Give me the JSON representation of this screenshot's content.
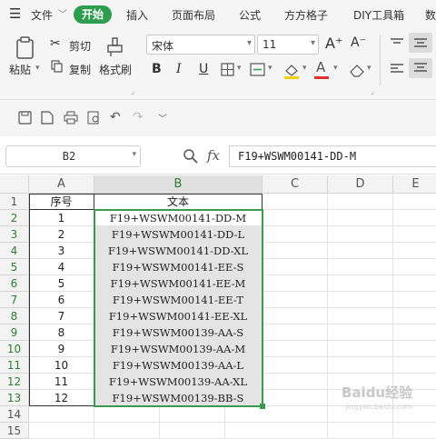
{
  "menubar": {
    "file": "文件",
    "tabs": [
      "开始",
      "插入",
      "页面布局",
      "公式",
      "方方格子",
      "DIY工具箱",
      "数"
    ]
  },
  "ribbon": {
    "paste": "粘贴",
    "cut": "剪切",
    "copy": "复制",
    "format_painter": "格式刷",
    "font_name": "宋体",
    "font_size": "11",
    "bold": "B",
    "italic": "I",
    "underline": "U",
    "increase_font": "A⁺",
    "decrease_font": "A⁻",
    "font_color_letter": "A",
    "colors": {
      "highlight": "#f5d000",
      "font": "#e03030",
      "accent": "#2e9d4f"
    }
  },
  "formula_bar": {
    "name_box": "B2",
    "fx": "fx",
    "formula": "F19+WSWM00141-DD-M"
  },
  "sheet": {
    "columns": [
      "A",
      "B",
      "C",
      "D",
      "E"
    ],
    "rows": [
      "1",
      "2",
      "3",
      "4",
      "5",
      "6",
      "7",
      "8",
      "9",
      "10",
      "11",
      "12",
      "13",
      "14",
      "15"
    ],
    "data": [
      [
        "序号",
        "文本"
      ],
      [
        "1",
        "F19+WSWM00141-DD-M"
      ],
      [
        "2",
        "F19+WSWM00141-DD-L"
      ],
      [
        "3",
        "F19+WSWM00141-DD-XL"
      ],
      [
        "4",
        "F19+WSWM00141-EE-S"
      ],
      [
        "5",
        "F19+WSWM00141-EE-M"
      ],
      [
        "6",
        "F19+WSWM00141-EE-T"
      ],
      [
        "7",
        "F19+WSWM00141-EE-XL"
      ],
      [
        "8",
        "F19+WSWM00139-AA-S"
      ],
      [
        "9",
        "F19+WSWM00139-AA-M"
      ],
      [
        "10",
        "F19+WSWM00139-AA-L"
      ],
      [
        "11",
        "F19+WSWM00139-AA-XL"
      ],
      [
        "12",
        "F19+WSWM00139-BB-S"
      ]
    ],
    "selected_column": "B",
    "selected_range": "B2:B13"
  },
  "watermark": {
    "text": "Baidu经验",
    "url": "jingyan.baidu.com"
  }
}
